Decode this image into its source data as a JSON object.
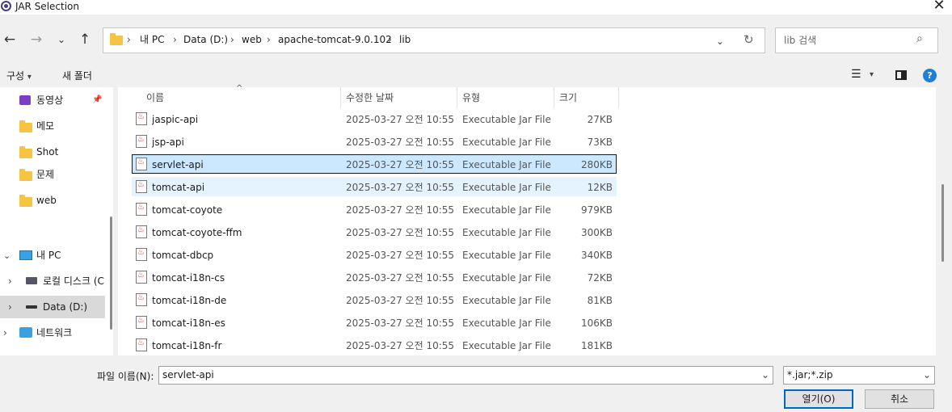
{
  "window": {
    "title": "JAR Selection"
  },
  "address": {
    "crumbs": [
      "내 PC",
      "Data (D:)",
      "web",
      "apache-tomcat-9.0.102",
      "lib"
    ]
  },
  "search": {
    "placeholder": "lib 검색"
  },
  "toolbar": {
    "organize": "구성",
    "new_folder": "새 폴더"
  },
  "nav": {
    "items": [
      {
        "label": "동영상",
        "icon": "video-icon",
        "pinned": true
      },
      {
        "label": "메모",
        "icon": "folder-icon"
      },
      {
        "label": "Shot",
        "icon": "folder-icon"
      },
      {
        "label": "문제",
        "icon": "folder-icon"
      },
      {
        "label": "web",
        "icon": "folder-icon"
      },
      {
        "label": "내 PC",
        "icon": "pc-icon",
        "expanded": true
      },
      {
        "label": "로컬 디스크 (C",
        "icon": "drive-icon"
      },
      {
        "label": "Data (D:)",
        "icon": "drive-icon",
        "selected": true
      },
      {
        "label": "네트워크",
        "icon": "network-icon"
      }
    ]
  },
  "columns": {
    "name": "이름",
    "modified": "수정한 날짜",
    "type": "유형",
    "size": "크기"
  },
  "files": [
    {
      "name": "jaspic-api",
      "modified": "2025-03-27 오전 10:55",
      "type": "Executable Jar File",
      "size": "27KB"
    },
    {
      "name": "jsp-api",
      "modified": "2025-03-27 오전 10:55",
      "type": "Executable Jar File",
      "size": "73KB"
    },
    {
      "name": "servlet-api",
      "modified": "2025-03-27 오전 10:55",
      "type": "Executable Jar File",
      "size": "280KB"
    },
    {
      "name": "tomcat-api",
      "modified": "2025-03-27 오전 10:55",
      "type": "Executable Jar File",
      "size": "12KB"
    },
    {
      "name": "tomcat-coyote",
      "modified": "2025-03-27 오전 10:55",
      "type": "Executable Jar File",
      "size": "979KB"
    },
    {
      "name": "tomcat-coyote-ffm",
      "modified": "2025-03-27 오전 10:55",
      "type": "Executable Jar File",
      "size": "300KB"
    },
    {
      "name": "tomcat-dbcp",
      "modified": "2025-03-27 오전 10:55",
      "type": "Executable Jar File",
      "size": "340KB"
    },
    {
      "name": "tomcat-i18n-cs",
      "modified": "2025-03-27 오전 10:55",
      "type": "Executable Jar File",
      "size": "72KB"
    },
    {
      "name": "tomcat-i18n-de",
      "modified": "2025-03-27 오전 10:55",
      "type": "Executable Jar File",
      "size": "81KB"
    },
    {
      "name": "tomcat-i18n-es",
      "modified": "2025-03-27 오전 10:55",
      "type": "Executable Jar File",
      "size": "106KB"
    },
    {
      "name": "tomcat-i18n-fr",
      "modified": "2025-03-27 오전 10:55",
      "type": "Executable Jar File",
      "size": "181KB"
    }
  ],
  "selected_file": "servlet-api",
  "hovered_file": "tomcat-api",
  "bottom": {
    "filename_label": "파일 이름(N):",
    "filename_value": "servlet-api",
    "filetype_value": "*.jar;*.zip",
    "open_button": "열기(O)",
    "cancel_button": "취소"
  },
  "colors": {
    "selection": "#cce8ff",
    "hover": "#e5f3ff",
    "accent": "#0067c0",
    "folder": "#f6c343"
  }
}
